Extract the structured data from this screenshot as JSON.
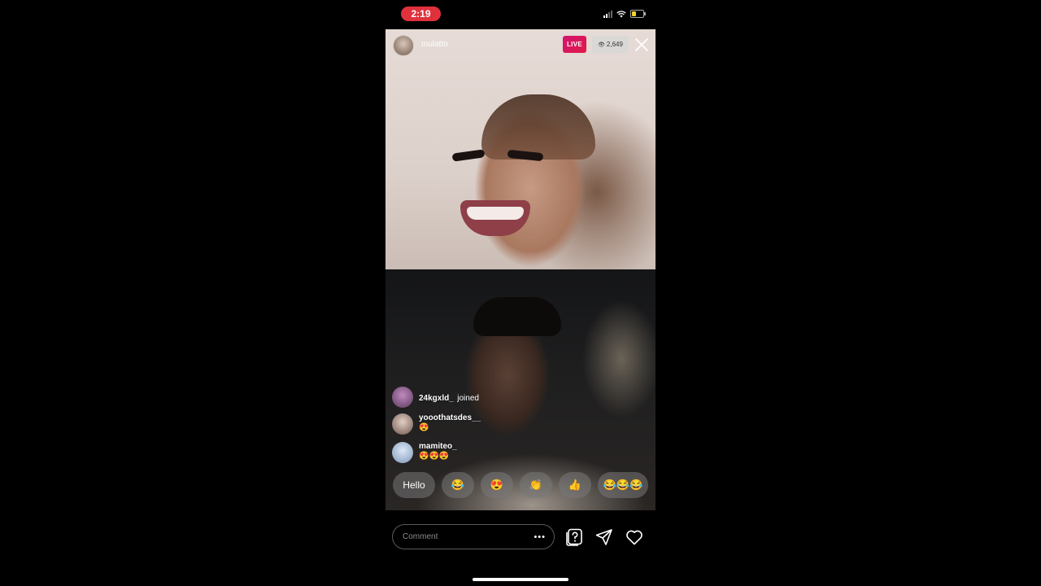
{
  "status_bar": {
    "time": "2:19"
  },
  "host": {
    "username": "mulatto",
    "live_label": "LIVE",
    "viewer_count": "2,649"
  },
  "comments": [
    {
      "username": "24kgxld_",
      "text": "joined",
      "avatar_color": "#8a5a8a"
    },
    {
      "username": "yooothatsdes__",
      "text": "😍",
      "avatar_color": "#b89a8c"
    },
    {
      "username": "mamiteo_",
      "text": "😍😍😍",
      "avatar_color": "#9fb4d6"
    }
  ],
  "quick_reactions": [
    "Hello",
    "😂",
    "😍",
    "👏",
    "👍",
    "😂😂😂"
  ],
  "composer": {
    "placeholder": "Comment",
    "more_label": "•••"
  },
  "icons": {
    "top": [
      "eye-icon",
      "close-icon"
    ],
    "bottom": [
      "question-sticker-icon",
      "send-icon",
      "heart-icon"
    ]
  },
  "colors": {
    "live_badge": "#d3146e",
    "time_pill": "#e0323c"
  }
}
